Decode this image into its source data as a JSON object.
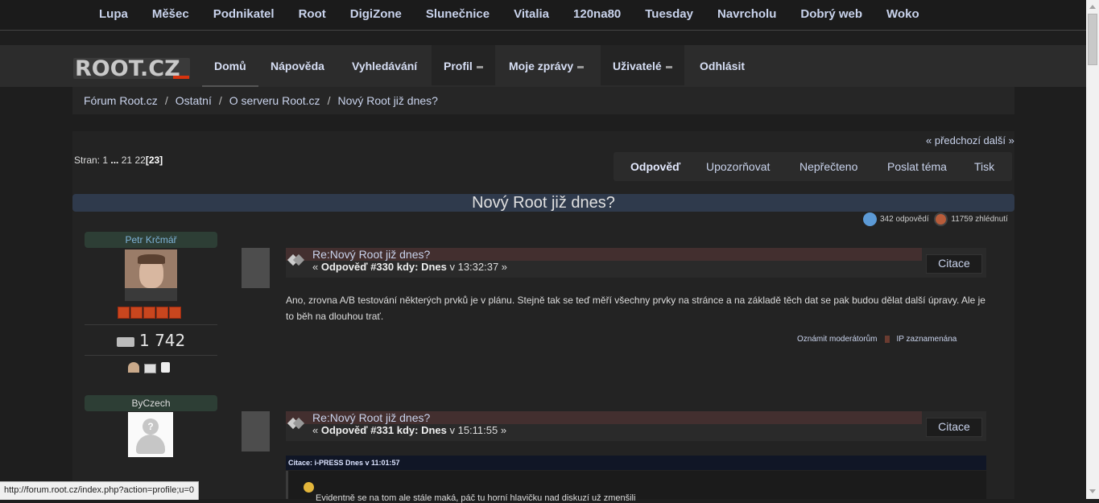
{
  "network_links": [
    "Lupa",
    "Měšec",
    "Podnikatel",
    "Root",
    "DigiZone",
    "Slunečnice",
    "Vitalia",
    "120na80",
    "Tuesday",
    "Navrcholu",
    "Dobrý web",
    "Woko"
  ],
  "logo_text": "ROOT.CZ",
  "nav": {
    "home": "Domů",
    "help": "Nápověda",
    "search": "Vyhledávání",
    "profile": "Profil",
    "messages": "Moje zprávy",
    "users": "Uživatelé",
    "logout": "Odhlásit"
  },
  "breadcrumb": [
    "Fórum Root.cz",
    "Ostatní",
    "O serveru Root.cz",
    "Nový Root již dnes?"
  ],
  "breadcrumb_sep": "/",
  "prevnext": "« předchozí další »",
  "pages": {
    "label": "Stran:",
    "p1": "1",
    "dots": "...",
    "p21": "21",
    "p22": "22",
    "current": "23"
  },
  "topic_buttons": {
    "reply": "Odpověď",
    "notify": "Upozorňovat",
    "unread": "Nepřečteno",
    "send": "Poslat téma",
    "print": "Tisk"
  },
  "topic_title": "Nový Root již dnes?",
  "stats": {
    "replies": "342 odpovědí",
    "views": "11759 zhlédnutí"
  },
  "users": [
    {
      "name": "Petr Krčmář",
      "posts": "1 742"
    },
    {
      "name": "ByCzech"
    }
  ],
  "posts": [
    {
      "title": "Re:Nový Root již dnes?",
      "meta_prefix": "« ",
      "meta_bold": "Odpověď #330 kdy: Dnes",
      "meta_time": " v 13:32:37 »",
      "quote_label": "Citace",
      "body": "Ano, zrovna A/B testování některých prvků je v plánu. Stejně tak se teď měří všechny prvky na stránce a na základě těch dat se pak budou dělat další úpravy. Ale je to běh na dlouhou trať.",
      "report": "Oznámit moderátorům",
      "ip": "IP zaznamenána"
    },
    {
      "title": "Re:Nový Root již dnes?",
      "meta_prefix": "« ",
      "meta_bold": "Odpověď #331 kdy: Dnes",
      "meta_time": " v 15:11:55 »",
      "quote_label": "Citace",
      "quote_head": "Citace: i-PRESS  Dnes v 11:01:57",
      "quote_text": "Evidentně se na tom ale stále maká, páč tu horní hlavičku nad diskuzí už zmenšili"
    }
  ],
  "status_url": "http://forum.root.cz/index.php?action=profile;u=0"
}
